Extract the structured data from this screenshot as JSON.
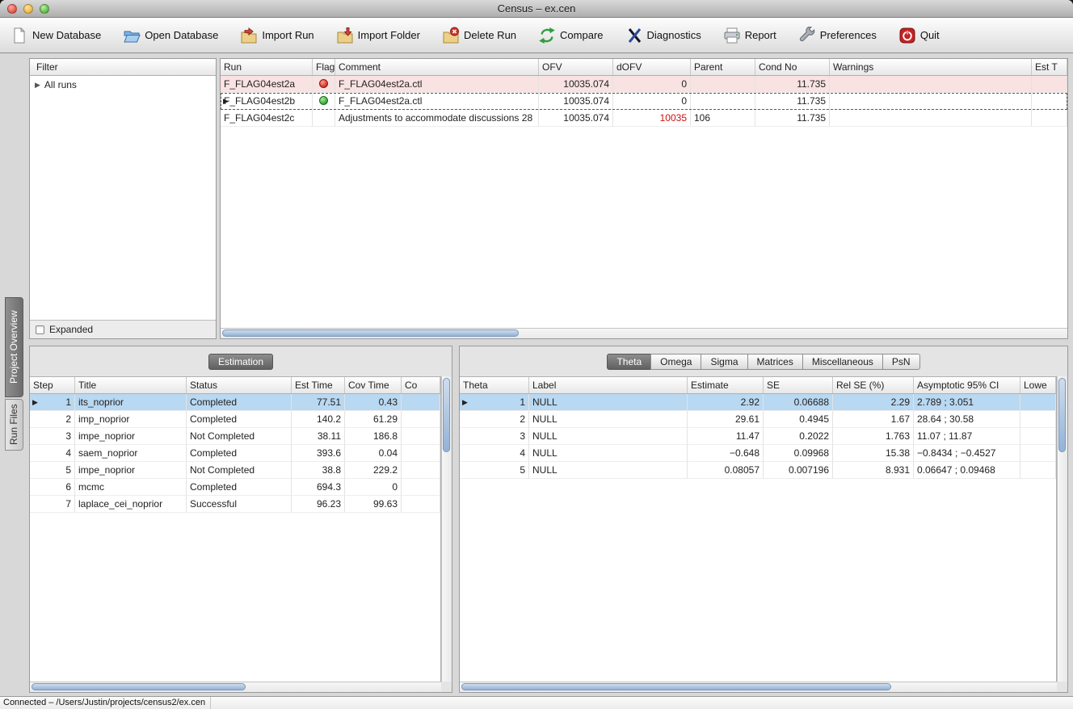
{
  "window": {
    "title": "Census – ex.cen"
  },
  "toolbar": {
    "items": [
      {
        "label": "New Database",
        "icon": "new-database-icon"
      },
      {
        "label": "Open Database",
        "icon": "open-database-icon"
      },
      {
        "label": "Import Run",
        "icon": "import-run-icon"
      },
      {
        "label": "Import Folder",
        "icon": "import-folder-icon"
      },
      {
        "label": "Delete Run",
        "icon": "delete-run-icon"
      },
      {
        "label": "Compare",
        "icon": "compare-icon"
      },
      {
        "label": "Diagnostics",
        "icon": "diagnostics-icon"
      },
      {
        "label": "Report",
        "icon": "report-icon"
      },
      {
        "label": "Preferences",
        "icon": "preferences-icon"
      },
      {
        "label": "Quit",
        "icon": "quit-icon"
      }
    ]
  },
  "side_tabs": {
    "items": [
      {
        "label": "Project Overview",
        "selected": true
      },
      {
        "label": "Run Files",
        "selected": false
      }
    ]
  },
  "filter_panel": {
    "title": "Filter",
    "root_item": "All runs",
    "expanded_label": "Expanded"
  },
  "run_table": {
    "columns": [
      "Run",
      "Flag",
      "Comment",
      "OFV",
      "dOFV",
      "Parent",
      "Cond No",
      "Warnings",
      "Est T"
    ],
    "rows": [
      {
        "run": "F_FLAG04est2a",
        "flag": "red",
        "comment": "F_FLAG04est2a.ctl",
        "ofv": "10035.074",
        "dofv": "0",
        "parent": "",
        "cond_no": "11.735",
        "warnings": "",
        "row_class": "pink"
      },
      {
        "run": "F_FLAG04est2b",
        "flag": "green",
        "comment": "F_FLAG04est2a.ctl",
        "ofv": "10035.074",
        "dofv": "0",
        "parent": "",
        "cond_no": "11.735",
        "warnings": "",
        "row_class": "current focus-row"
      },
      {
        "run": "F_FLAG04est2c",
        "flag": "",
        "comment": "Adjustments to accommodate discussions 28",
        "ofv": "10035.074",
        "dofv": "10035",
        "dofv_class": "alert",
        "parent": "106",
        "cond_no": "11.735",
        "warnings": "",
        "row_class": ""
      }
    ]
  },
  "estimation_panel": {
    "tab_label": "Estimation",
    "columns": [
      "Step",
      "Title",
      "Status",
      "Est Time",
      "Cov Time",
      "Co"
    ],
    "rows": [
      {
        "step": "1",
        "title": "its_noprior",
        "status": "Completed",
        "est_time": "77.51",
        "cov_time": "0.43",
        "row_class": "current sel"
      },
      {
        "step": "2",
        "title": "imp_noprior",
        "status": "Completed",
        "est_time": "140.2",
        "cov_time": "61.29",
        "row_class": ""
      },
      {
        "step": "3",
        "title": "impe_noprior",
        "status": "Not Completed",
        "est_time": "38.11",
        "cov_time": "186.8",
        "row_class": ""
      },
      {
        "step": "4",
        "title": "saem_noprior",
        "status": "Completed",
        "est_time": "393.6",
        "cov_time": "0.04",
        "row_class": ""
      },
      {
        "step": "5",
        "title": "impe_noprior",
        "status": "Not Completed",
        "est_time": "38.8",
        "cov_time": "229.2",
        "row_class": ""
      },
      {
        "step": "6",
        "title": "mcmc",
        "status": "Completed",
        "est_time": "694.3",
        "cov_time": "0",
        "row_class": ""
      },
      {
        "step": "7",
        "title": "laplace_cei_noprior",
        "status": "Successful",
        "est_time": "96.23",
        "cov_time": "99.63",
        "row_class": ""
      }
    ]
  },
  "theta_panel": {
    "tabs": [
      {
        "label": "Theta",
        "selected": true
      },
      {
        "label": "Omega",
        "selected": false
      },
      {
        "label": "Sigma",
        "selected": false
      },
      {
        "label": "Matrices",
        "selected": false
      },
      {
        "label": "Miscellaneous",
        "selected": false
      },
      {
        "label": "PsN",
        "selected": false
      }
    ],
    "columns": [
      "Theta",
      "Label",
      "Estimate",
      "SE",
      "Rel SE (%)",
      "Asymptotic 95% CI",
      "Lowe"
    ],
    "rows": [
      {
        "theta": "1",
        "label": "NULL",
        "estimate": "2.92",
        "se": "0.06688",
        "rel_se": "2.29",
        "ci": "2.789 ; 3.051",
        "row_class": "current sel"
      },
      {
        "theta": "2",
        "label": "NULL",
        "estimate": "29.61",
        "se": "0.4945",
        "rel_se": "1.67",
        "ci": "28.64 ; 30.58",
        "row_class": ""
      },
      {
        "theta": "3",
        "label": "NULL",
        "estimate": "11.47",
        "se": "0.2022",
        "rel_se": "1.763",
        "ci": "11.07 ; 11.87",
        "row_class": ""
      },
      {
        "theta": "4",
        "label": "NULL",
        "estimate": "−0.648",
        "se": "0.09968",
        "rel_se": "15.38",
        "ci": "−0.8434 ; −0.4527",
        "row_class": ""
      },
      {
        "theta": "5",
        "label": "NULL",
        "estimate": "0.08057",
        "se": "0.007196",
        "rel_se": "8.931",
        "ci": "0.06647 ; 0.09468",
        "row_class": ""
      }
    ]
  },
  "status_bar": {
    "text": "Connected –  /Users/Justin/projects/census2/ex.cen"
  },
  "colors": {
    "selection_blue": "#b9d8f1",
    "flagged_row_pink": "#f8e2e2",
    "flag_red": "#d42a1e",
    "flag_green": "#2aa32e",
    "dofv_alert_red": "#cc1111",
    "selected_tab_grey": "#6e6e6e"
  }
}
